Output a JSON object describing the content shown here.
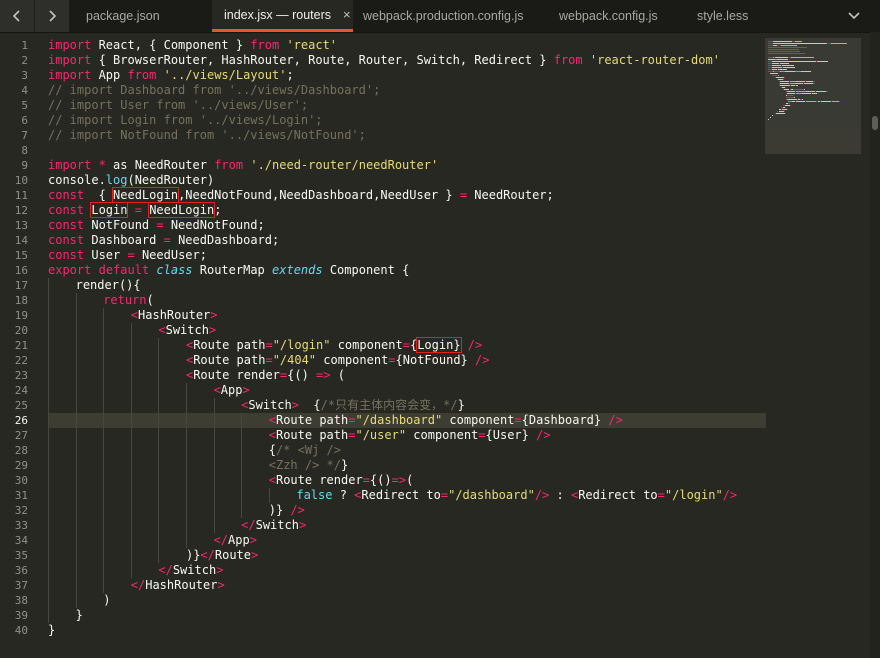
{
  "tabs": [
    {
      "label": "package.json",
      "active": false
    },
    {
      "label": "index.jsx — routers",
      "active": true
    },
    {
      "label": "webpack.production.config.js",
      "active": false
    },
    {
      "label": "webpack.config.js",
      "active": false
    },
    {
      "label": "style.less",
      "active": false
    }
  ],
  "close_glyph": "×",
  "colors": {
    "keyword": "#f92672",
    "string": "#e6db74",
    "function": "#66d9ef",
    "comment": "#75715e",
    "text": "#f8f8f2",
    "background": "#272822",
    "highlight_box": "#e0211d",
    "active_tab_underline": "#e05a2b"
  },
  "icons": {
    "back": "chevron-left-icon",
    "forward": "chevron-right-icon",
    "menu": "chevron-down-icon"
  },
  "current_line": 26,
  "lines": [
    {
      "n": 1,
      "indent": 0,
      "tokens": [
        [
          "k",
          "import"
        ],
        [
          "t",
          " React, { Component } "
        ],
        [
          "k",
          "from"
        ],
        [
          "t",
          " "
        ],
        [
          "s",
          "'react'"
        ]
      ]
    },
    {
      "n": 2,
      "indent": 0,
      "tokens": [
        [
          "k",
          "import"
        ],
        [
          "t",
          " { BrowserRouter, HashRouter, Route, Router, Switch, Redirect } "
        ],
        [
          "k",
          "from"
        ],
        [
          "t",
          " "
        ],
        [
          "s",
          "'react-router-dom'"
        ]
      ]
    },
    {
      "n": 3,
      "indent": 0,
      "tokens": [
        [
          "k",
          "import"
        ],
        [
          "t",
          " App "
        ],
        [
          "k",
          "from"
        ],
        [
          "t",
          " "
        ],
        [
          "s",
          "'../views/Layout'"
        ],
        [
          "t",
          ";"
        ]
      ]
    },
    {
      "n": 4,
      "indent": 0,
      "tokens": [
        [
          "c",
          "// import Dashboard from '../views/Dashboard';"
        ]
      ]
    },
    {
      "n": 5,
      "indent": 0,
      "tokens": [
        [
          "c",
          "// import User from '../views/User';"
        ]
      ]
    },
    {
      "n": 6,
      "indent": 0,
      "tokens": [
        [
          "c",
          "// import Login from '../views/Login';"
        ]
      ]
    },
    {
      "n": 7,
      "indent": 0,
      "tokens": [
        [
          "c",
          "// import NotFound from '../views/NotFound';"
        ]
      ]
    },
    {
      "n": 8,
      "indent": 0,
      "tokens": []
    },
    {
      "n": 9,
      "indent": 0,
      "tokens": [
        [
          "k",
          "import"
        ],
        [
          "t",
          " "
        ],
        [
          "k",
          "*"
        ],
        [
          "t",
          " as NeedRouter "
        ],
        [
          "k",
          "from"
        ],
        [
          "t",
          " "
        ],
        [
          "s",
          "'./need-router/needRouter'"
        ]
      ]
    },
    {
      "n": 10,
      "indent": 0,
      "tokens": [
        [
          "t",
          "console."
        ],
        [
          "f",
          "log"
        ],
        [
          "t",
          "(NeedRouter)"
        ]
      ]
    },
    {
      "n": 11,
      "indent": 0,
      "tokens": [
        [
          "k",
          "const"
        ],
        [
          "t",
          "  { "
        ],
        [
          "tb",
          "NeedLogin"
        ],
        [
          "t",
          ",NeedNotFound,NeedDashboard,NeedUser } "
        ],
        [
          "k",
          "="
        ],
        [
          "t",
          " NeedRouter;"
        ]
      ]
    },
    {
      "n": 12,
      "indent": 0,
      "tokens": [
        [
          "k",
          "const"
        ],
        [
          "t",
          " "
        ],
        [
          "tb",
          "Login"
        ],
        [
          "t",
          " "
        ],
        [
          "k",
          "="
        ],
        [
          "t",
          " "
        ],
        [
          "tb",
          "NeedLogin"
        ],
        [
          "t",
          ";"
        ]
      ]
    },
    {
      "n": 13,
      "indent": 0,
      "tokens": [
        [
          "k",
          "const"
        ],
        [
          "t",
          " NotFound "
        ],
        [
          "k",
          "="
        ],
        [
          "t",
          " NeedNotFound;"
        ]
      ]
    },
    {
      "n": 14,
      "indent": 0,
      "tokens": [
        [
          "k",
          "const"
        ],
        [
          "t",
          " Dashboard "
        ],
        [
          "k",
          "="
        ],
        [
          "t",
          " NeedDashboard;"
        ]
      ]
    },
    {
      "n": 15,
      "indent": 0,
      "tokens": [
        [
          "k",
          "const"
        ],
        [
          "t",
          " User "
        ],
        [
          "k",
          "="
        ],
        [
          "t",
          " NeedUser;"
        ]
      ]
    },
    {
      "n": 16,
      "indent": 0,
      "tokens": [
        [
          "k",
          "export"
        ],
        [
          "t",
          " "
        ],
        [
          "k",
          "default"
        ],
        [
          "t",
          " "
        ],
        [
          "fi",
          "class"
        ],
        [
          "t",
          " RouterMap "
        ],
        [
          "fi",
          "extends"
        ],
        [
          "t",
          " Component {"
        ]
      ]
    },
    {
      "n": 17,
      "indent": 1,
      "tokens": [
        [
          "t",
          "render(){"
        ]
      ]
    },
    {
      "n": 18,
      "indent": 2,
      "tokens": [
        [
          "k",
          "return"
        ],
        [
          "t",
          "("
        ]
      ]
    },
    {
      "n": 19,
      "indent": 3,
      "tokens": [
        [
          "k",
          "<"
        ],
        [
          "t",
          "HashRouter"
        ],
        [
          "k",
          ">"
        ]
      ]
    },
    {
      "n": 20,
      "indent": 4,
      "tokens": [
        [
          "k",
          "<"
        ],
        [
          "t",
          "Switch"
        ],
        [
          "k",
          ">"
        ]
      ]
    },
    {
      "n": 21,
      "indent": 5,
      "tokens": [
        [
          "k",
          "<"
        ],
        [
          "t",
          "Route path"
        ],
        [
          "k",
          "="
        ],
        [
          "s",
          "\"/login\""
        ],
        [
          "t",
          " component"
        ],
        [
          "k",
          "="
        ],
        [
          "t",
          "{"
        ],
        [
          "tb",
          "Login}"
        ],
        [
          "t",
          " "
        ],
        [
          "k",
          "/>"
        ]
      ]
    },
    {
      "n": 22,
      "indent": 5,
      "tokens": [
        [
          "k",
          "<"
        ],
        [
          "t",
          "Route path"
        ],
        [
          "k",
          "="
        ],
        [
          "s",
          "\"/404\""
        ],
        [
          "t",
          " component"
        ],
        [
          "k",
          "="
        ],
        [
          "t",
          "{NotFound} "
        ],
        [
          "k",
          "/>"
        ]
      ]
    },
    {
      "n": 23,
      "indent": 5,
      "tokens": [
        [
          "k",
          "<"
        ],
        [
          "t",
          "Route render"
        ],
        [
          "k",
          "="
        ],
        [
          "t",
          "{() "
        ],
        [
          "k",
          "=>"
        ],
        [
          "t",
          " ("
        ]
      ]
    },
    {
      "n": 24,
      "indent": 6,
      "tokens": [
        [
          "k",
          "<"
        ],
        [
          "t",
          "App"
        ],
        [
          "k",
          ">"
        ]
      ]
    },
    {
      "n": 25,
      "indent": 7,
      "tokens": [
        [
          "k",
          "<"
        ],
        [
          "t",
          "Switch"
        ],
        [
          "k",
          ">"
        ],
        [
          "t",
          "  {"
        ],
        [
          "c",
          "/*只有主体内容会变，*/"
        ],
        [
          "t",
          "}"
        ]
      ]
    },
    {
      "n": 26,
      "indent": 8,
      "tokens": [
        [
          "k",
          "<"
        ],
        [
          "t",
          "Route path"
        ],
        [
          "k",
          "="
        ],
        [
          "s",
          "\"/dashboard\""
        ],
        [
          "t",
          " component"
        ],
        [
          "k",
          "="
        ],
        [
          "t",
          "{Dashboard} "
        ],
        [
          "k",
          "/>"
        ]
      ]
    },
    {
      "n": 27,
      "indent": 8,
      "tokens": [
        [
          "k",
          "<"
        ],
        [
          "t",
          "Route path"
        ],
        [
          "k",
          "="
        ],
        [
          "s",
          "\"/user\""
        ],
        [
          "t",
          " component"
        ],
        [
          "k",
          "="
        ],
        [
          "t",
          "{User} "
        ],
        [
          "k",
          "/>"
        ]
      ]
    },
    {
      "n": 28,
      "indent": 8,
      "tokens": [
        [
          "t",
          "{"
        ],
        [
          "c",
          "/* <Wj />"
        ]
      ]
    },
    {
      "n": 29,
      "indent": 8,
      "tokens": [
        [
          "c",
          "<Zzh /> */"
        ],
        [
          "t",
          "}"
        ]
      ]
    },
    {
      "n": 30,
      "indent": 8,
      "tokens": [
        [
          "k",
          "<"
        ],
        [
          "t",
          "Route render"
        ],
        [
          "k",
          "="
        ],
        [
          "t",
          "{()"
        ],
        [
          "k",
          "=>"
        ],
        [
          "t",
          "("
        ]
      ]
    },
    {
      "n": 31,
      "indent": 9,
      "tokens": [
        [
          "f",
          "false"
        ],
        [
          "t",
          " ? "
        ],
        [
          "k",
          "<"
        ],
        [
          "t",
          "Redirect to"
        ],
        [
          "k",
          "="
        ],
        [
          "s",
          "\"/dashboard\""
        ],
        [
          "k",
          "/>"
        ],
        [
          "t",
          " : "
        ],
        [
          "k",
          "<"
        ],
        [
          "t",
          "Redirect to"
        ],
        [
          "k",
          "="
        ],
        [
          "s",
          "\"/login\""
        ],
        [
          "k",
          "/>"
        ]
      ]
    },
    {
      "n": 32,
      "indent": 8,
      "tokens": [
        [
          "t",
          ")} "
        ],
        [
          "k",
          "/>"
        ]
      ]
    },
    {
      "n": 33,
      "indent": 7,
      "tokens": [
        [
          "k",
          "</"
        ],
        [
          "t",
          "Switch"
        ],
        [
          "k",
          ">"
        ]
      ]
    },
    {
      "n": 34,
      "indent": 6,
      "tokens": [
        [
          "k",
          "</"
        ],
        [
          "t",
          "App"
        ],
        [
          "k",
          ">"
        ]
      ]
    },
    {
      "n": 35,
      "indent": 5,
      "tokens": [
        [
          "t",
          ")}"
        ],
        [
          "k",
          "</"
        ],
        [
          "t",
          "Route"
        ],
        [
          "k",
          ">"
        ]
      ]
    },
    {
      "n": 36,
      "indent": 4,
      "tokens": [
        [
          "k",
          "</"
        ],
        [
          "t",
          "Switch"
        ],
        [
          "k",
          ">"
        ]
      ]
    },
    {
      "n": 37,
      "indent": 3,
      "tokens": [
        [
          "k",
          "</"
        ],
        [
          "t",
          "HashRouter"
        ],
        [
          "k",
          ">"
        ]
      ]
    },
    {
      "n": 38,
      "indent": 2,
      "tokens": [
        [
          "t",
          ")"
        ]
      ]
    },
    {
      "n": 39,
      "indent": 1,
      "tokens": [
        [
          "t",
          "}"
        ]
      ]
    },
    {
      "n": 40,
      "indent": 0,
      "tokens": [
        [
          "t",
          "}"
        ]
      ]
    }
  ]
}
